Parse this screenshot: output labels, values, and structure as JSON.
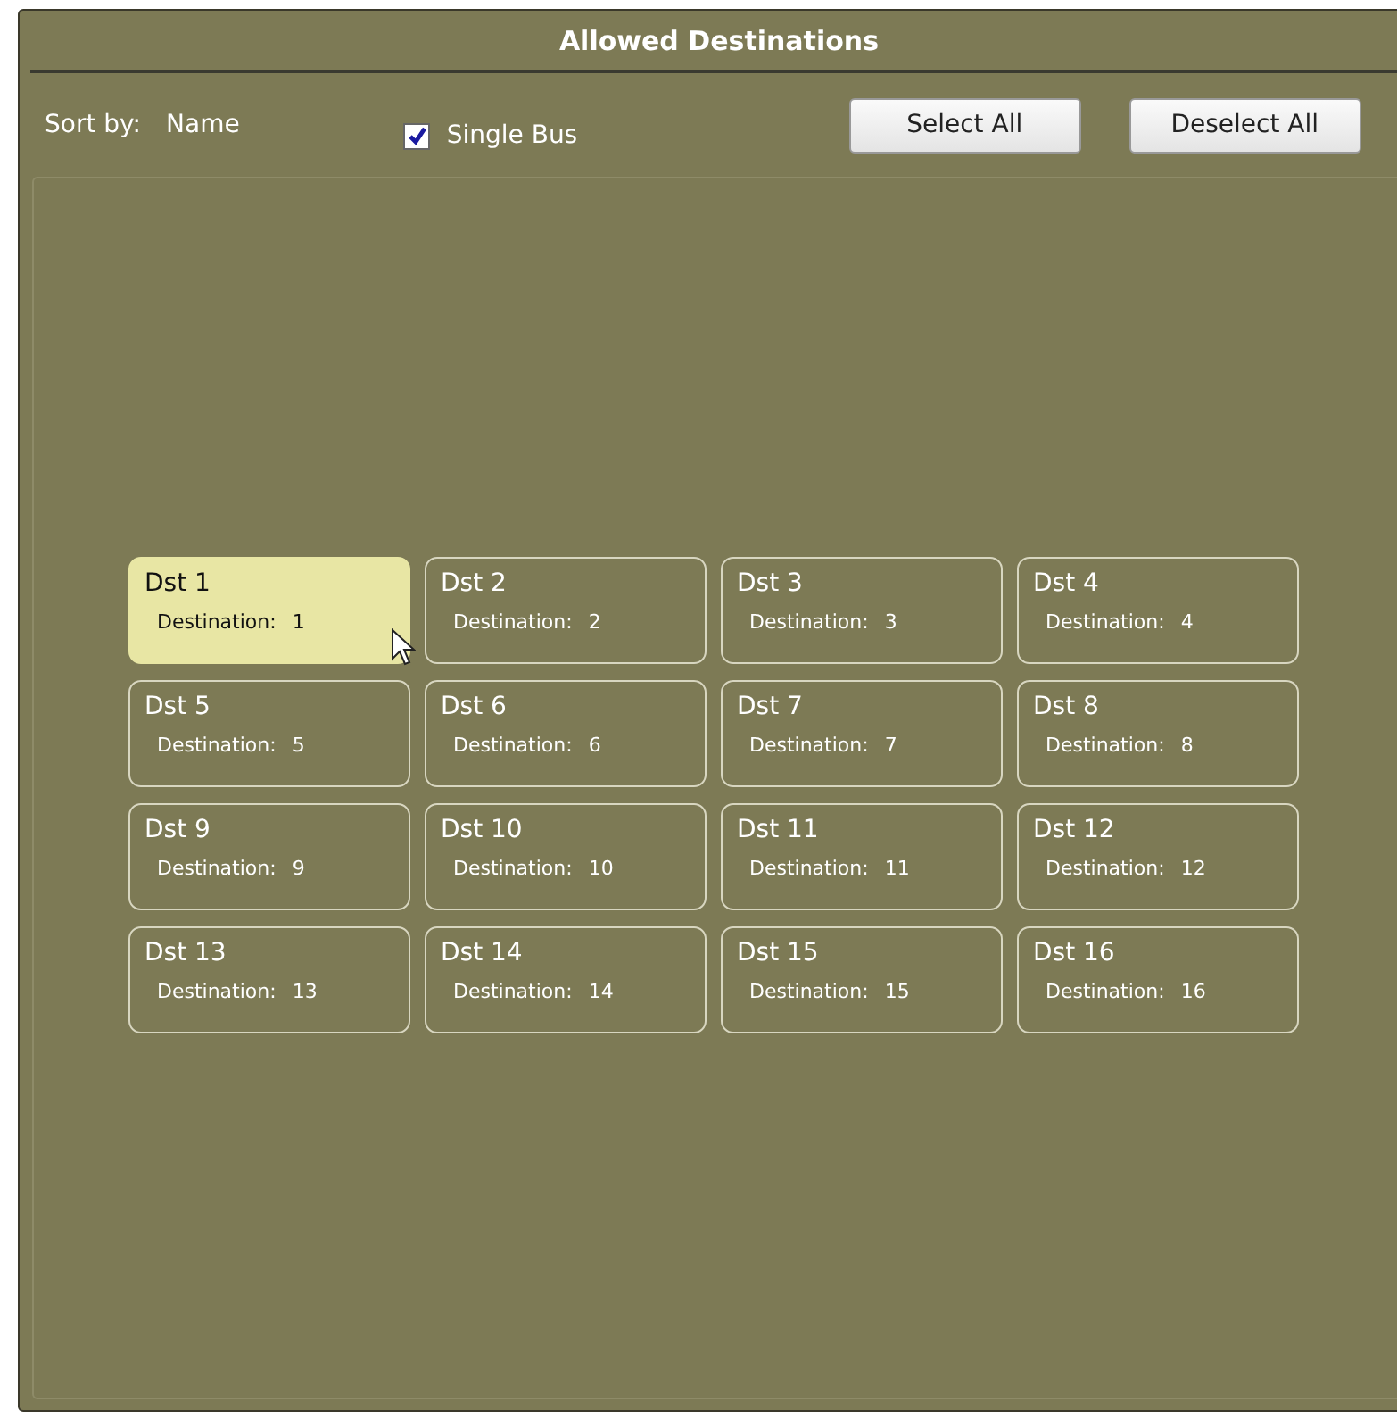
{
  "window": {
    "title": "Allowed Destinations"
  },
  "toolbar": {
    "sort_label": "Sort by:",
    "sort_value": "Name",
    "single_bus": {
      "label": "Single Bus",
      "checked": true
    },
    "buttons": [
      "Select All",
      "Deselect All"
    ]
  },
  "destinations": [
    {
      "name": "Dst 1",
      "label": "Destination:",
      "number": "1",
      "selected": true
    },
    {
      "name": "Dst 2",
      "label": "Destination:",
      "number": "2",
      "selected": false
    },
    {
      "name": "Dst 3",
      "label": "Destination:",
      "number": "3",
      "selected": false
    },
    {
      "name": "Dst 4",
      "label": "Destination:",
      "number": "4",
      "selected": false
    },
    {
      "name": "Dst 5",
      "label": "Destination:",
      "number": "5",
      "selected": false
    },
    {
      "name": "Dst 6",
      "label": "Destination:",
      "number": "6",
      "selected": false
    },
    {
      "name": "Dst 7",
      "label": "Destination:",
      "number": "7",
      "selected": false
    },
    {
      "name": "Dst 8",
      "label": "Destination:",
      "number": "8",
      "selected": false
    },
    {
      "name": "Dst 9",
      "label": "Destination:",
      "number": "9",
      "selected": false
    },
    {
      "name": "Dst 10",
      "label": "Destination:",
      "number": "10",
      "selected": false
    },
    {
      "name": "Dst 11",
      "label": "Destination:",
      "number": "11",
      "selected": false
    },
    {
      "name": "Dst 12",
      "label": "Destination:",
      "number": "12",
      "selected": false
    },
    {
      "name": "Dst 13",
      "label": "Destination:",
      "number": "13",
      "selected": false
    },
    {
      "name": "Dst 14",
      "label": "Destination:",
      "number": "14",
      "selected": false
    },
    {
      "name": "Dst 15",
      "label": "Destination:",
      "number": "15",
      "selected": false
    },
    {
      "name": "Dst 16",
      "label": "Destination:",
      "number": "16",
      "selected": false
    }
  ]
}
